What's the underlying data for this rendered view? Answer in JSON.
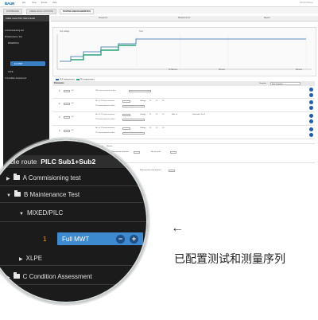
{
  "app": {
    "logo": "BAUR",
    "menu": [
      "File",
      "View",
      "Extras",
      "Help"
    ],
    "top_right": "BAUR Software"
  },
  "tabs": [
    "DASHBOARD",
    "CABLE FAULT LOCATION",
    "TESTING AND DIAGNOSTICS"
  ],
  "subheader": [
    "Sequence",
    "Measurement",
    "Report"
  ],
  "tree_panel": {
    "header": "Cable route  PILC Sub1+Sub2",
    "rows": [
      "A Commissioning test",
      "B Maintenance Test",
      "MIXED/PILC",
      "Full MWT",
      "XLPE",
      "C Condition Assessment"
    ]
  },
  "chart": {
    "left_label": "Test voltage",
    "right_label": "Time",
    "legend": [
      "VLF measurement",
      "TD measurement"
    ],
    "ticks": [
      "10 Minutes",
      "Minutes",
      "Minutes"
    ]
  },
  "parameters": {
    "title": "Parameter",
    "template_label": "Template",
    "template_value": "New Template",
    "rows": [
      {
        "num": "1",
        "unit": "kV",
        "l1": "VLF measurement section",
        "l2": "VLF measurement section"
      },
      {
        "num": "2",
        "unit": "kV",
        "l1": "No. of TD measurements",
        "l2": "TD measurement section"
      },
      {
        "num": "3",
        "unit": "kV",
        "l1": "No. of TD measurements",
        "l2": "TD measurement section"
      },
      {
        "num": "4",
        "unit": "kV",
        "l1": "No. of TD measurements",
        "l2": "TD measurement section"
      }
    ],
    "voltage_label": "Voltage",
    "checkboxes": [
      "L1",
      "L2",
      "L3"
    ],
    "extra": [
      "Max. tri",
      "Determine Tan δ",
      "Measurement duration",
      "Minutes",
      "No. of cycles",
      "Measurement step duration"
    ]
  },
  "lens": {
    "title_prefix": "Cable route",
    "title_route": "PILC Sub1+Sub2",
    "items": [
      {
        "label": "A Commisioning test"
      },
      {
        "label": "B Maintenance Test"
      },
      {
        "label": "MIXED/PILC"
      },
      {
        "label": "Full MWT",
        "index": "1"
      },
      {
        "label": "XLPE"
      },
      {
        "label": "C Condition Assessment"
      }
    ],
    "btn_minus": "−",
    "btn_plus": "+"
  },
  "arrow": "←",
  "caption": "已配置测试和测量序列"
}
